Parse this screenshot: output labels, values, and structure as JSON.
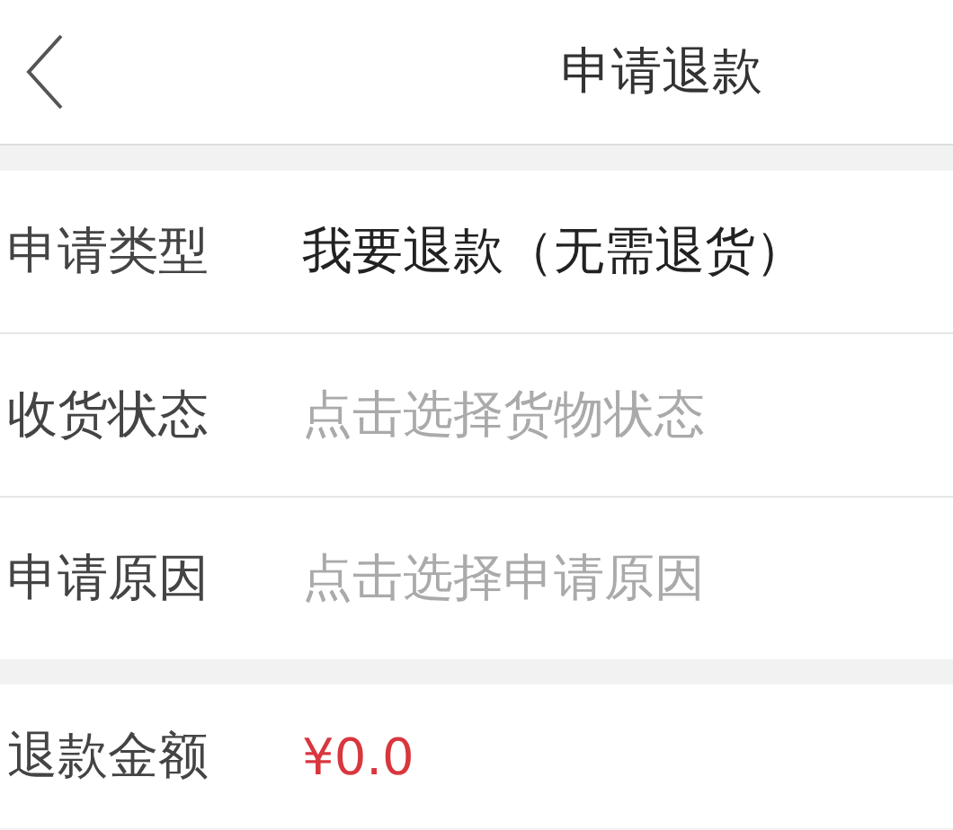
{
  "header": {
    "title": "申请退款"
  },
  "sections": [
    {
      "rows": [
        {
          "label": "申请类型",
          "value": "我要退款（无需退货）"
        },
        {
          "label": "收货状态",
          "placeholder": "点击选择货物状态"
        },
        {
          "label": "申请原因",
          "placeholder": "点击选择申请原因"
        }
      ]
    },
    {
      "rows": [
        {
          "label": "退款金额",
          "value": "¥0.0",
          "kind": "amount"
        }
      ]
    }
  ]
}
